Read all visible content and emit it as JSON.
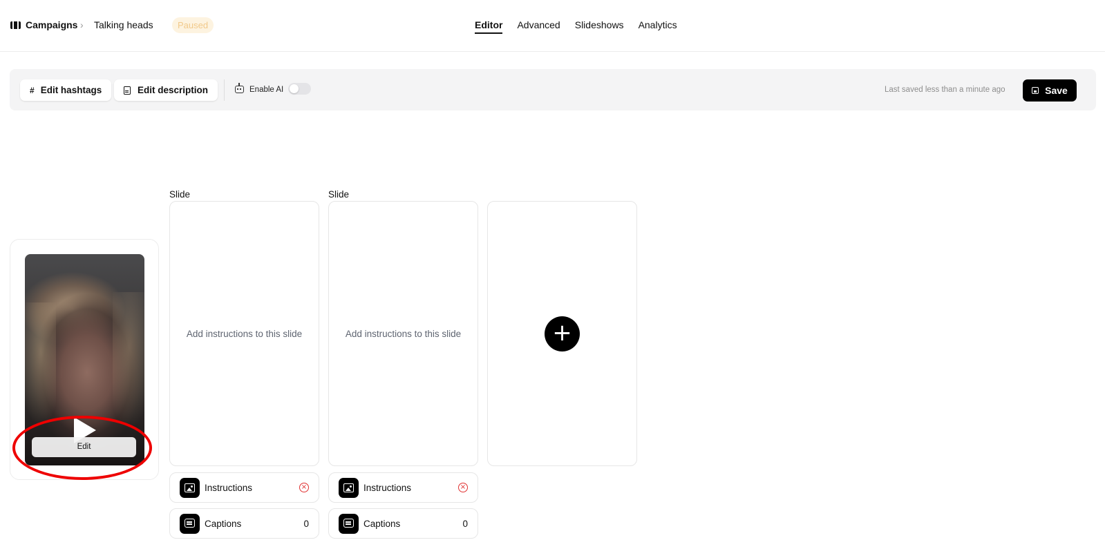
{
  "header": {
    "breadcrumb_root": "Campaigns",
    "breadcrumb_separator": "›",
    "breadcrumb_leaf": "Talking heads",
    "status": "Paused",
    "tabs": [
      {
        "label": "Editor",
        "active": true
      },
      {
        "label": "Advanced",
        "active": false
      },
      {
        "label": "Slideshows",
        "active": false
      },
      {
        "label": "Analytics",
        "active": false
      }
    ]
  },
  "toolbar": {
    "hashtags_label": "Edit hashtags",
    "hashtags_icon": "#",
    "description_label": "Edit description",
    "ai_label": "Enable AI",
    "ai_enabled": false,
    "saved_text": "Last saved less than a minute ago",
    "save_label": "Save"
  },
  "video": {
    "edit_label": "Edit"
  },
  "slides": [
    {
      "label": "Slide",
      "placeholder": "Add instructions to this slide",
      "instructions_label": "Instructions",
      "captions_label": "Captions",
      "captions_count": "0"
    },
    {
      "label": "Slide",
      "placeholder": "Add instructions to this slide",
      "instructions_label": "Instructions",
      "captions_label": "Captions",
      "captions_count": "0"
    }
  ],
  "add_slide_symbol": "+",
  "remove_symbol": "×",
  "colors": {
    "accent": "#000000",
    "status_badge_bg": "#fdf3e0",
    "status_badge_text": "#f1c98a",
    "remove_red": "#e03131",
    "annotation_red": "#ee0000"
  }
}
